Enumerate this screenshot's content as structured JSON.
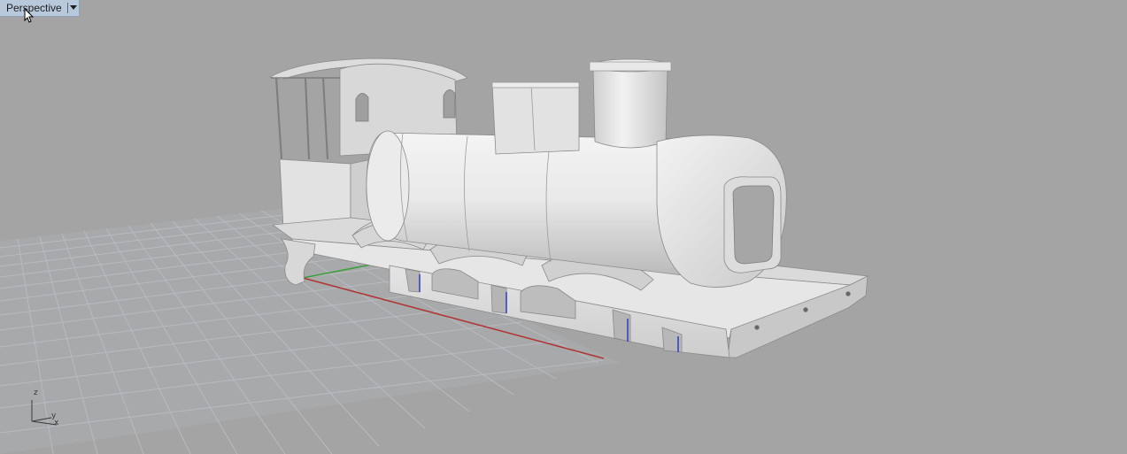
{
  "viewport": {
    "title": "Perspective",
    "menu_icon": "chevron-down-icon"
  },
  "axes": {
    "z_label": "z",
    "y_label": "y",
    "x_label": "x"
  },
  "colors": {
    "background": "#a4a4a4",
    "grid": "#b6b9bd",
    "model": "#e6e6e6",
    "x_axis": "#b03535",
    "y_axis": "#3aa03a",
    "tab": "#b9c9dc"
  },
  "model": {
    "name": "locomotive"
  }
}
